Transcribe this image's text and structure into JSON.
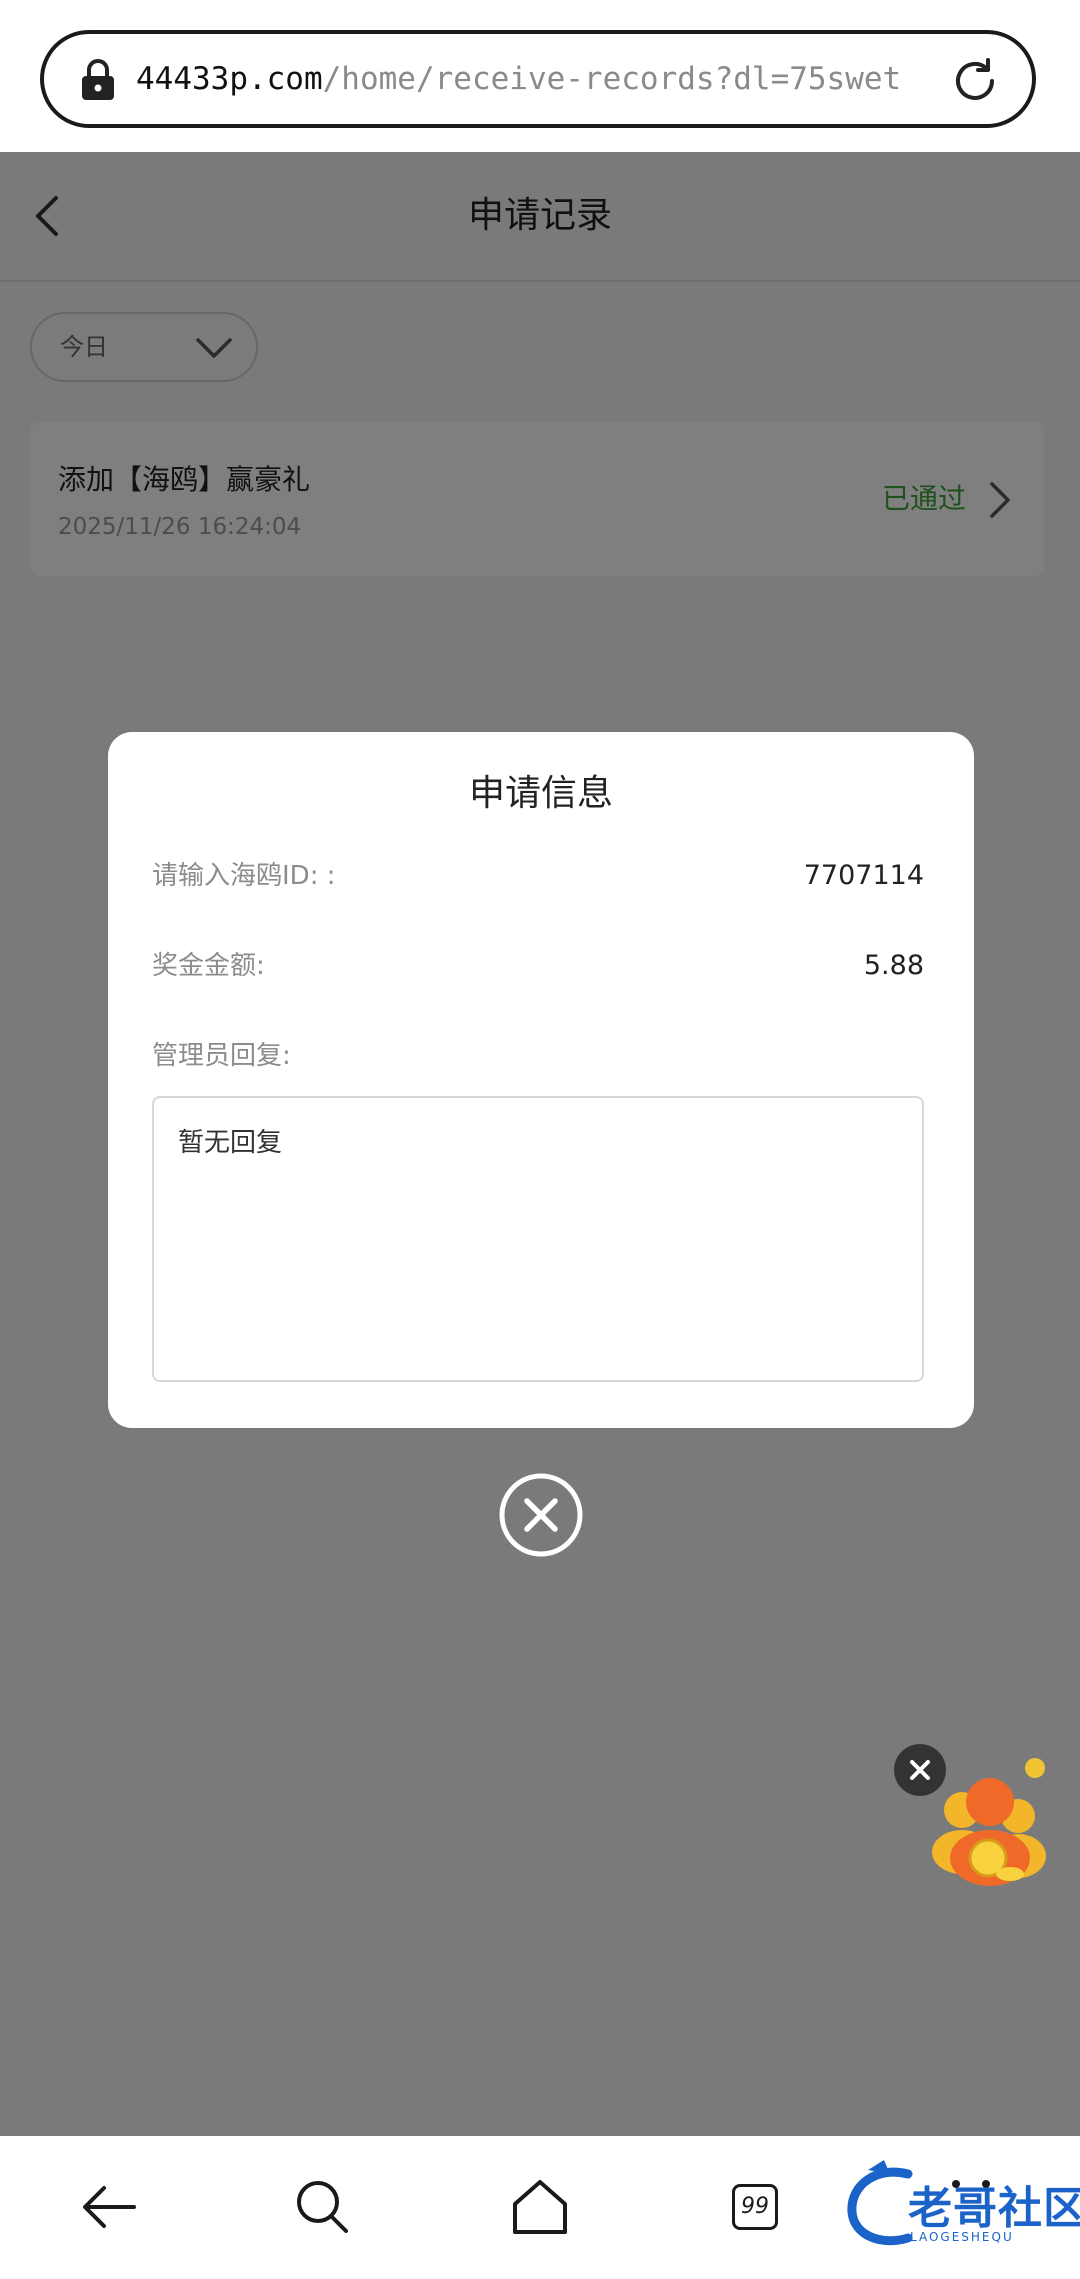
{
  "browser": {
    "url_host": "44433p.com",
    "url_path": "/home/receive-records?dl=75swet"
  },
  "header": {
    "title": "申请记录"
  },
  "filter": {
    "selected": "今日"
  },
  "records": [
    {
      "title": "添加【海鸥】赢豪礼",
      "time": "2025/11/26 16:24:04",
      "status": "已通过"
    }
  ],
  "modal": {
    "title": "申请信息",
    "rows": [
      {
        "label": "请输入海鸥ID: :",
        "value": "7707114"
      },
      {
        "label": "奖金金额:",
        "value": "5.88"
      }
    ],
    "reply_label": "管理员回复:",
    "reply_text": "暂无回复"
  },
  "bottom_nav": {
    "tab_count": "99",
    "icons": [
      "back-icon",
      "search-icon",
      "home-icon",
      "tabs-icon",
      "more-icon"
    ]
  },
  "watermark": {
    "text": "老哥社区",
    "subtext": "LAOGESHEQU"
  },
  "colors": {
    "status_green": "#3da33a",
    "overlay": "rgba(0,0,0,0.5)",
    "watermark_blue": "#1b63c9"
  }
}
